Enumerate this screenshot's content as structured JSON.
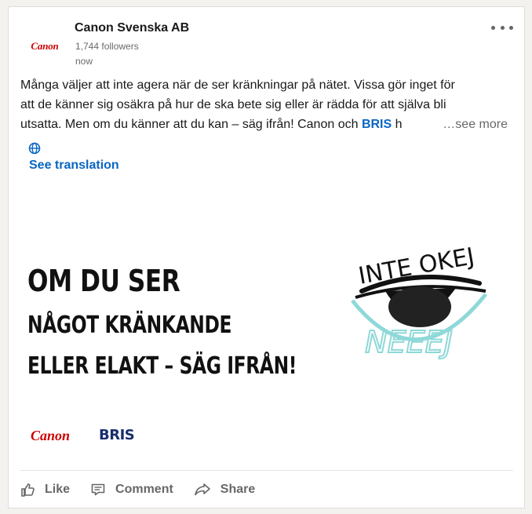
{
  "post": {
    "author": {
      "logo_text": "Canon",
      "name": "Canon Svenska AB",
      "followers": "1,744 followers",
      "timestamp": "now"
    },
    "menu_icon": "more-horizontal-icon",
    "text_line_1": "Många väljer att inte agera när de ser kränkningar på nätet. Vissa gör inget för",
    "text_line_2": "att de känner sig osäkra på hur de ska bete sig eller är rädda för att själva bli",
    "text_line_3_prefix": "utsatta. Men om du känner att du kan – säg ifrån! Canon och ",
    "text_line_3_link": "BRIS",
    "text_line_3_suffix": " h",
    "see_more": "…see more",
    "translation_icon": "globe-icon",
    "see_translation": "See translation"
  },
  "media": {
    "headline_1": "OM DU SER",
    "headline_2": "NÅGOT KRÄNKANDE",
    "headline_3": "ELLER ELAKT – SÄG IFRÅN!",
    "eye_text_top": "INTE OKEJ",
    "eye_text_bottom": "NEEEJ",
    "logo_canon": "Canon",
    "logo_bris": "BRIS",
    "colors": {
      "headline": "#111111",
      "eye_outline": "#8fd8d8",
      "canon_red": "#cc0000",
      "bris_navy": "#1a2e6e"
    }
  },
  "actions": [
    {
      "label": "Like",
      "icon": "thumbs-up-icon"
    },
    {
      "label": "Comment",
      "icon": "comment-icon"
    },
    {
      "label": "Share",
      "icon": "share-arrow-icon"
    }
  ],
  "colors": {
    "link": "#0a66c2",
    "background": "#f3f2ef",
    "card": "#ffffff"
  }
}
